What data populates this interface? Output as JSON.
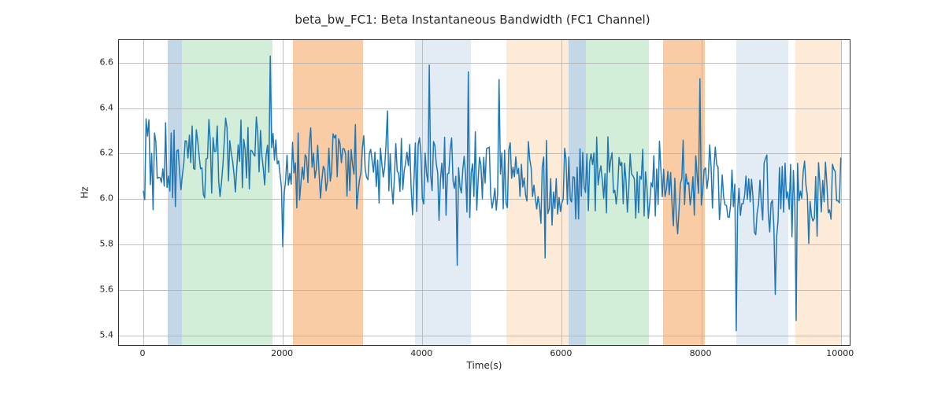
{
  "chart_data": {
    "type": "line",
    "title": "beta_bw_FC1: Beta Instantaneous Bandwidth (FC1 Channel)",
    "xlabel": "Time(s)",
    "ylabel": "Hz",
    "xlim": [
      -350,
      10150
    ],
    "ylim": [
      5.35,
      6.7
    ],
    "xticks": [
      0,
      2000,
      4000,
      6000,
      8000,
      10000
    ],
    "yticks": [
      5.4,
      5.6,
      5.8,
      6.0,
      6.2,
      6.4,
      6.6
    ],
    "line_color": "#1f77b4",
    "bands": [
      {
        "start": 350,
        "end": 550,
        "color": "#6b9bc3",
        "alpha": 0.4
      },
      {
        "start": 550,
        "end": 1850,
        "color": "#8fd19e",
        "alpha": 0.4
      },
      {
        "start": 2150,
        "end": 3150,
        "color": "#f5a35b",
        "alpha": 0.55
      },
      {
        "start": 3900,
        "end": 4700,
        "color": "#b8cce4",
        "alpha": 0.4
      },
      {
        "start": 5200,
        "end": 6100,
        "color": "#fcd9b6",
        "alpha": 0.55
      },
      {
        "start": 6100,
        "end": 6350,
        "color": "#6b9bc3",
        "alpha": 0.4
      },
      {
        "start": 6350,
        "end": 7250,
        "color": "#8fd19e",
        "alpha": 0.4
      },
      {
        "start": 7450,
        "end": 8050,
        "color": "#f5a35b",
        "alpha": 0.55
      },
      {
        "start": 8500,
        "end": 9250,
        "color": "#b8cce4",
        "alpha": 0.4
      },
      {
        "start": 9350,
        "end": 10000,
        "color": "#fcd9b6",
        "alpha": 0.55
      }
    ],
    "x": [],
    "y": [],
    "series_note": "x sampled every 20s over 0..10000; y values listed in parallel 'y'"
  }
}
